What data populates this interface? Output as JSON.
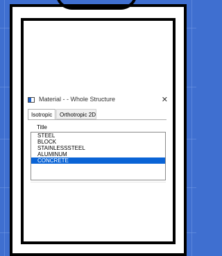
{
  "window": {
    "title": "Material -  - Whole Structure",
    "close": "✕"
  },
  "tabs": [
    {
      "label": "Isotropic",
      "active": true
    },
    {
      "label": "Orthotropic 2D",
      "active": false
    }
  ],
  "list": {
    "header": "Title",
    "items": [
      "STEEL",
      "BLOCK",
      "STAINLESSSTEEL",
      "ALUMINUM",
      "CONCRETE"
    ],
    "selected": "CONCRETE"
  },
  "colors": {
    "selection": "#0a64d6",
    "background": "#3f6fd0"
  }
}
